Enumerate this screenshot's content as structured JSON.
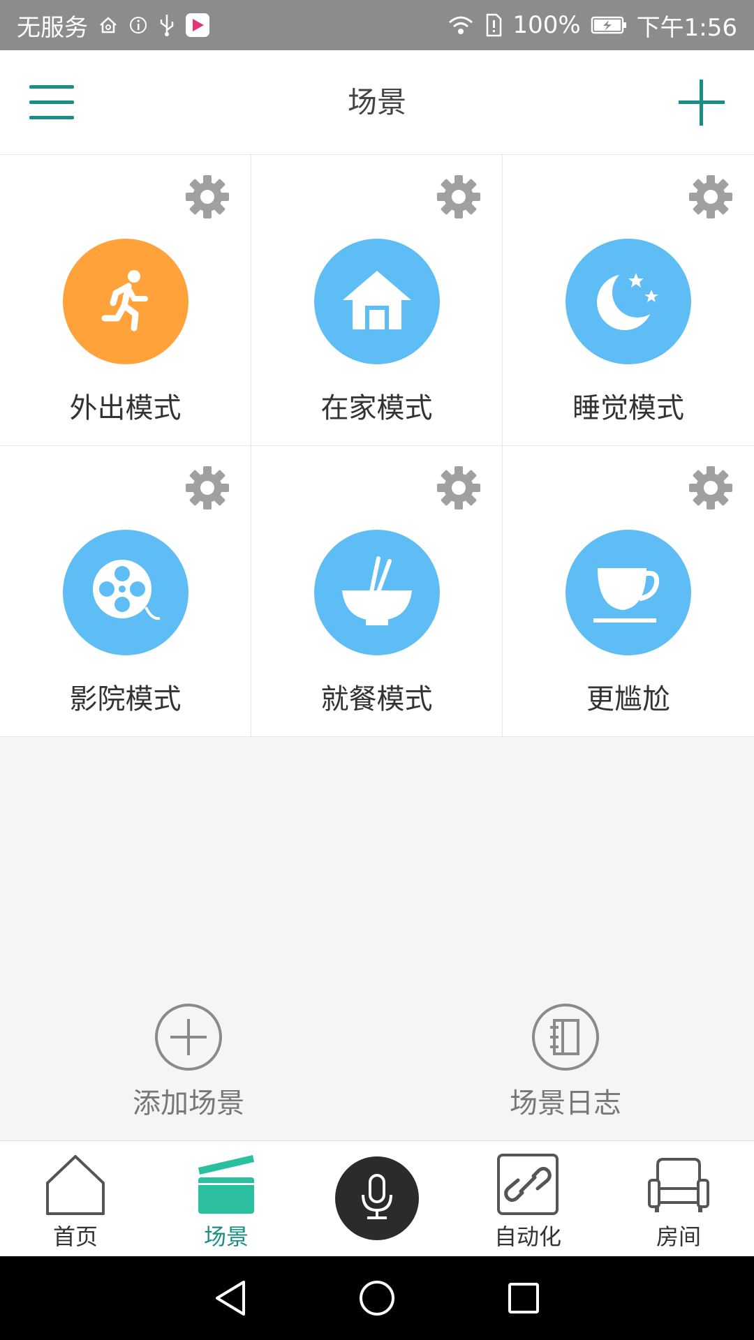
{
  "status_bar": {
    "carrier": "无服务",
    "battery": "100%",
    "time": "下午1:56",
    "icons": [
      "home-outline-icon",
      "info-icon",
      "usb-icon",
      "app-icon",
      "wifi-icon",
      "sim-alert-icon",
      "battery-charging-icon"
    ]
  },
  "header": {
    "title": "场景",
    "menu_icon": "hamburger-menu-icon",
    "add_icon": "plus-icon"
  },
  "colors": {
    "accent": "#1a8e84",
    "orange": "#ffa23a",
    "blue": "#5dbdf4",
    "gray_icon": "#a0a0a0"
  },
  "scenes": [
    {
      "label": "外出模式",
      "icon": "running-person-icon",
      "color": "#ffa23a"
    },
    {
      "label": "在家模式",
      "icon": "house-icon",
      "color": "#5dbdf4"
    },
    {
      "label": "睡觉模式",
      "icon": "moon-stars-icon",
      "color": "#5dbdf4"
    },
    {
      "label": "影院模式",
      "icon": "film-reel-icon",
      "color": "#5dbdf4"
    },
    {
      "label": "就餐模式",
      "icon": "bowl-chopsticks-icon",
      "color": "#5dbdf4"
    },
    {
      "label": "更尴尬",
      "icon": "coffee-cup-icon",
      "color": "#5dbdf4"
    }
  ],
  "actions": {
    "add_scene": "添加场景",
    "scene_log": "场景日志"
  },
  "tabs": [
    {
      "label": "首页",
      "icon": "home-icon",
      "active": false
    },
    {
      "label": "场景",
      "icon": "clapperboard-icon",
      "active": true
    },
    {
      "label": "",
      "icon": "microphone-icon",
      "active": false
    },
    {
      "label": "自动化",
      "icon": "link-icon",
      "active": false
    },
    {
      "label": "房间",
      "icon": "sofa-icon",
      "active": false
    }
  ]
}
